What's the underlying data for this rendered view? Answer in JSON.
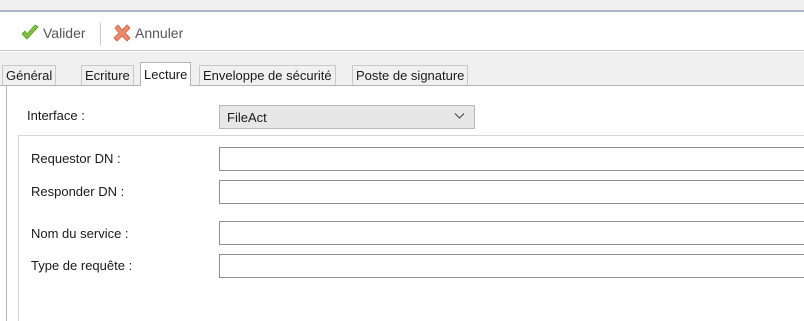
{
  "toolbar": {
    "validate_label": "Valider",
    "cancel_label": "Annuler"
  },
  "tabs": [
    {
      "label": "Général",
      "active": false
    },
    {
      "label": "Ecriture",
      "active": false
    },
    {
      "label": "Lecture",
      "active": true
    },
    {
      "label": "Enveloppe de sécurité",
      "active": false
    },
    {
      "label": "Poste de signature",
      "active": false
    }
  ],
  "form": {
    "interface_label": "Interface :",
    "interface_value": "FileAct",
    "requestor_dn_label": "Requestor DN :",
    "requestor_dn_value": "",
    "responder_dn_label": "Responder DN :",
    "responder_dn_value": "",
    "service_name_label": "Nom du service :",
    "service_name_value": "",
    "request_type_label": "Type de requête :",
    "request_type_value": ""
  },
  "icons": {
    "validate": "checkmark-icon",
    "cancel": "cancel-x-icon",
    "dropdown": "chevron-down-icon"
  },
  "colors": {
    "validate_icon": "#7cc23a",
    "cancel_icon": "#e8744f",
    "toolbar_text": "#555555",
    "select_bg": "#e7e7e7"
  }
}
